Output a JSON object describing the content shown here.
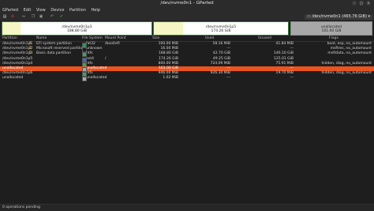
{
  "window": {
    "title": "/dev/nvme0n1 - GParted"
  },
  "menu": [
    "GParted",
    "Edit",
    "View",
    "Device",
    "Partition",
    "Help"
  ],
  "device_selector": "/dev/nvme0n1 (465.76 GiB)",
  "disk_map": [
    {
      "name": "/dev/nvme0n1p3",
      "size": "188.80 GiB",
      "color": "#2e7d32",
      "used_color": "#f5f5c5",
      "used_fraction": 0.12
    },
    {
      "name": "/dev/nvme0n1p5",
      "size": "174.26 GiB",
      "color": "#2e7d32",
      "used_color": "#f5f5c5",
      "used_fraction": 0.22
    },
    {
      "name": "unallocated",
      "size": "101.00 GiB",
      "color": "#a8a8a8",
      "used_color": "#a8a8a8",
      "used_fraction": 0
    }
  ],
  "columns": [
    "Partition",
    "Name",
    "File System",
    "Mount Point",
    "Size",
    "Used",
    "Unused",
    "Flags"
  ],
  "rows": [
    {
      "partition": "/dev/nvme0n1p1",
      "key": true,
      "name": "EFI system partition",
      "fs": "fat32",
      "fs_color": "#18a058",
      "mount": "/boot/efi",
      "size": "100.00 MiB",
      "used": "58.16 MiB",
      "unused": "41.84 MiB",
      "flags": "boot, esp, no_automount",
      "selected": false
    },
    {
      "partition": "/dev/nvme0n1p2",
      "key": true,
      "name": "Microsoft reserved partition",
      "fs": "unknown",
      "fs_color": "#1c1c1c",
      "mount": "",
      "size": "16.00 MiB",
      "used": "---",
      "unused": "---",
      "flags": "msftres, no_automount",
      "selected": false
    },
    {
      "partition": "/dev/nvme0n1p3",
      "key": true,
      "name": "Basic data partition",
      "fs": "ntfs",
      "fs_color": "#3aa55c",
      "mount": "",
      "size": "188.80 GiB",
      "used": "42.70 GiB",
      "unused": "146.10 GiB",
      "flags": "msftdata, no_automount",
      "selected": false
    },
    {
      "partition": "/dev/nvme0n1p5",
      "key": false,
      "name": "",
      "fs": "ext4",
      "fs_color": "#2c6fbf",
      "mount": "/",
      "size": "174.26 GiB",
      "used": "49.25 GiB",
      "unused": "125.01 GiB",
      "flags": "",
      "selected": false
    },
    {
      "partition": "/dev/nvme0n1p4",
      "key": false,
      "name": "",
      "fs": "ntfs",
      "fs_color": "#3aa55c",
      "mount": "",
      "size": "800.00 MiB",
      "used": "724.09 MiB",
      "unused": "75.91 MiB",
      "flags": "hidden, diag, no_automount",
      "selected": false
    },
    {
      "partition": "unallocated",
      "key": false,
      "name": "",
      "fs": "unallocated",
      "fs_color": "#a8a8a8",
      "mount": "",
      "size": "101.00 GiB",
      "used": "---",
      "unused": "---",
      "flags": "",
      "selected": true
    },
    {
      "partition": "/dev/nvme0n1p6",
      "key": false,
      "name": "",
      "fs": "ntfs",
      "fs_color": "#3aa55c",
      "mount": "",
      "size": "946.00 MiB",
      "used": "926.30 MiB",
      "unused": "19.70 MiB",
      "flags": "hidden, diag, no_automount",
      "selected": false
    },
    {
      "partition": "unallocated",
      "key": false,
      "name": "",
      "fs": "unallocated",
      "fs_color": "#a8a8a8",
      "mount": "",
      "size": "1.02 MiB",
      "used": "---",
      "unused": "---",
      "flags": "",
      "selected": false
    }
  ],
  "status": "0 operations pending"
}
